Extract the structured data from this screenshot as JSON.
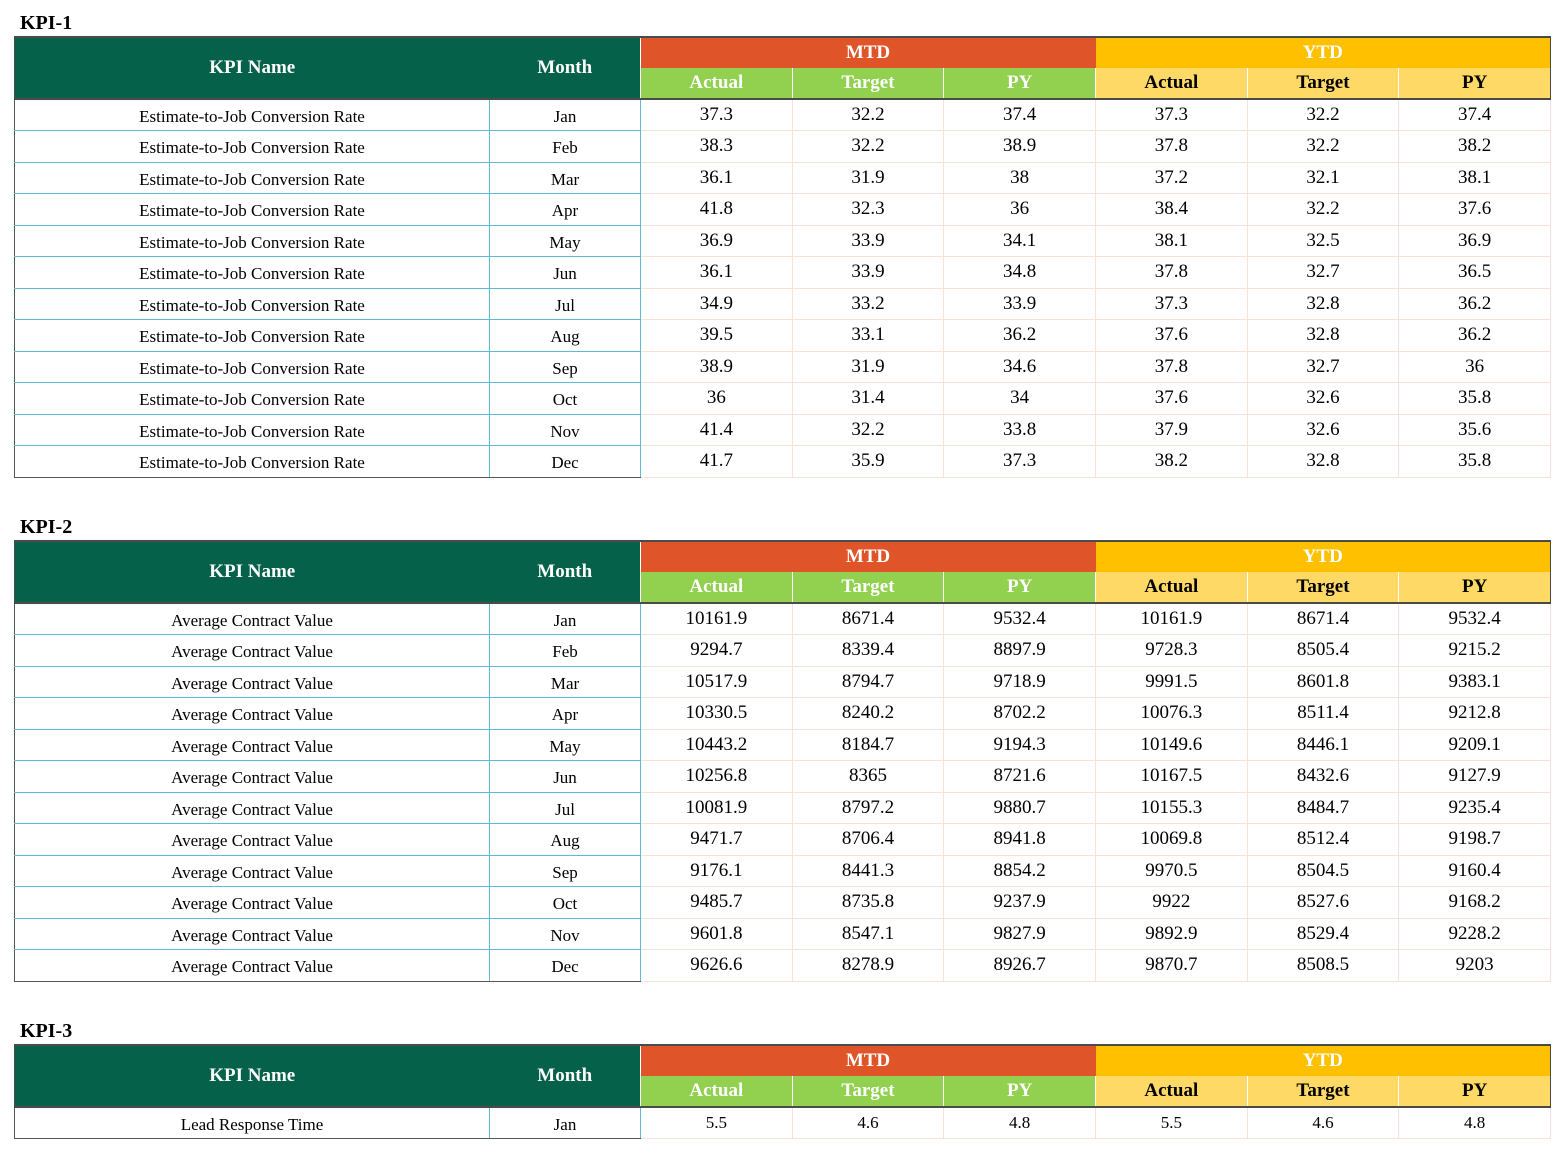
{
  "headers": {
    "kpi_name": "KPI Name",
    "month": "Month",
    "mtd": "MTD",
    "ytd": "YTD",
    "actual": "Actual",
    "target": "Target",
    "py": "PY"
  },
  "colors": {
    "header_dark": "#05614a",
    "mtd": "#e0542a",
    "ytd": "#ffc000",
    "mtd_sub": "#92d050",
    "ytd_sub": "#ffd966"
  },
  "sections": [
    {
      "title": "KPI-1",
      "kpi_name": "Estimate-to-Job Conversion Rate",
      "rows": [
        {
          "month": "Jan",
          "mtd_actual": "37.3",
          "mtd_target": "32.2",
          "mtd_py": "37.4",
          "ytd_actual": "37.3",
          "ytd_target": "32.2",
          "ytd_py": "37.4"
        },
        {
          "month": "Feb",
          "mtd_actual": "38.3",
          "mtd_target": "32.2",
          "mtd_py": "38.9",
          "ytd_actual": "37.8",
          "ytd_target": "32.2",
          "ytd_py": "38.2"
        },
        {
          "month": "Mar",
          "mtd_actual": "36.1",
          "mtd_target": "31.9",
          "mtd_py": "38",
          "ytd_actual": "37.2",
          "ytd_target": "32.1",
          "ytd_py": "38.1"
        },
        {
          "month": "Apr",
          "mtd_actual": "41.8",
          "mtd_target": "32.3",
          "mtd_py": "36",
          "ytd_actual": "38.4",
          "ytd_target": "32.2",
          "ytd_py": "37.6"
        },
        {
          "month": "May",
          "mtd_actual": "36.9",
          "mtd_target": "33.9",
          "mtd_py": "34.1",
          "ytd_actual": "38.1",
          "ytd_target": "32.5",
          "ytd_py": "36.9"
        },
        {
          "month": "Jun",
          "mtd_actual": "36.1",
          "mtd_target": "33.9",
          "mtd_py": "34.8",
          "ytd_actual": "37.8",
          "ytd_target": "32.7",
          "ytd_py": "36.5"
        },
        {
          "month": "Jul",
          "mtd_actual": "34.9",
          "mtd_target": "33.2",
          "mtd_py": "33.9",
          "ytd_actual": "37.3",
          "ytd_target": "32.8",
          "ytd_py": "36.2"
        },
        {
          "month": "Aug",
          "mtd_actual": "39.5",
          "mtd_target": "33.1",
          "mtd_py": "36.2",
          "ytd_actual": "37.6",
          "ytd_target": "32.8",
          "ytd_py": "36.2"
        },
        {
          "month": "Sep",
          "mtd_actual": "38.9",
          "mtd_target": "31.9",
          "mtd_py": "34.6",
          "ytd_actual": "37.8",
          "ytd_target": "32.7",
          "ytd_py": "36"
        },
        {
          "month": "Oct",
          "mtd_actual": "36",
          "mtd_target": "31.4",
          "mtd_py": "34",
          "ytd_actual": "37.6",
          "ytd_target": "32.6",
          "ytd_py": "35.8"
        },
        {
          "month": "Nov",
          "mtd_actual": "41.4",
          "mtd_target": "32.2",
          "mtd_py": "33.8",
          "ytd_actual": "37.9",
          "ytd_target": "32.6",
          "ytd_py": "35.6"
        },
        {
          "month": "Dec",
          "mtd_actual": "41.7",
          "mtd_target": "35.9",
          "mtd_py": "37.3",
          "ytd_actual": "38.2",
          "ytd_target": "32.8",
          "ytd_py": "35.8"
        }
      ]
    },
    {
      "title": "KPI-2",
      "kpi_name": "Average Contract Value",
      "rows": [
        {
          "month": "Jan",
          "mtd_actual": "10161.9",
          "mtd_target": "8671.4",
          "mtd_py": "9532.4",
          "ytd_actual": "10161.9",
          "ytd_target": "8671.4",
          "ytd_py": "9532.4"
        },
        {
          "month": "Feb",
          "mtd_actual": "9294.7",
          "mtd_target": "8339.4",
          "mtd_py": "8897.9",
          "ytd_actual": "9728.3",
          "ytd_target": "8505.4",
          "ytd_py": "9215.2"
        },
        {
          "month": "Mar",
          "mtd_actual": "10517.9",
          "mtd_target": "8794.7",
          "mtd_py": "9718.9",
          "ytd_actual": "9991.5",
          "ytd_target": "8601.8",
          "ytd_py": "9383.1"
        },
        {
          "month": "Apr",
          "mtd_actual": "10330.5",
          "mtd_target": "8240.2",
          "mtd_py": "8702.2",
          "ytd_actual": "10076.3",
          "ytd_target": "8511.4",
          "ytd_py": "9212.8"
        },
        {
          "month": "May",
          "mtd_actual": "10443.2",
          "mtd_target": "8184.7",
          "mtd_py": "9194.3",
          "ytd_actual": "10149.6",
          "ytd_target": "8446.1",
          "ytd_py": "9209.1"
        },
        {
          "month": "Jun",
          "mtd_actual": "10256.8",
          "mtd_target": "8365",
          "mtd_py": "8721.6",
          "ytd_actual": "10167.5",
          "ytd_target": "8432.6",
          "ytd_py": "9127.9"
        },
        {
          "month": "Jul",
          "mtd_actual": "10081.9",
          "mtd_target": "8797.2",
          "mtd_py": "9880.7",
          "ytd_actual": "10155.3",
          "ytd_target": "8484.7",
          "ytd_py": "9235.4"
        },
        {
          "month": "Aug",
          "mtd_actual": "9471.7",
          "mtd_target": "8706.4",
          "mtd_py": "8941.8",
          "ytd_actual": "10069.8",
          "ytd_target": "8512.4",
          "ytd_py": "9198.7"
        },
        {
          "month": "Sep",
          "mtd_actual": "9176.1",
          "mtd_target": "8441.3",
          "mtd_py": "8854.2",
          "ytd_actual": "9970.5",
          "ytd_target": "8504.5",
          "ytd_py": "9160.4"
        },
        {
          "month": "Oct",
          "mtd_actual": "9485.7",
          "mtd_target": "8735.8",
          "mtd_py": "9237.9",
          "ytd_actual": "9922",
          "ytd_target": "8527.6",
          "ytd_py": "9168.2"
        },
        {
          "month": "Nov",
          "mtd_actual": "9601.8",
          "mtd_target": "8547.1",
          "mtd_py": "9827.9",
          "ytd_actual": "9892.9",
          "ytd_target": "8529.4",
          "ytd_py": "9228.2"
        },
        {
          "month": "Dec",
          "mtd_actual": "9626.6",
          "mtd_target": "8278.9",
          "mtd_py": "8926.7",
          "ytd_actual": "9870.7",
          "ytd_target": "8508.5",
          "ytd_py": "9203"
        }
      ]
    },
    {
      "title": "KPI-3",
      "kpi_name": "Lead Response Time",
      "rows": [
        {
          "month": "Jan",
          "mtd_actual": "5.5",
          "mtd_target": "4.6",
          "mtd_py": "4.8",
          "ytd_actual": "5.5",
          "ytd_target": "4.6",
          "ytd_py": "4.8"
        }
      ]
    }
  ]
}
